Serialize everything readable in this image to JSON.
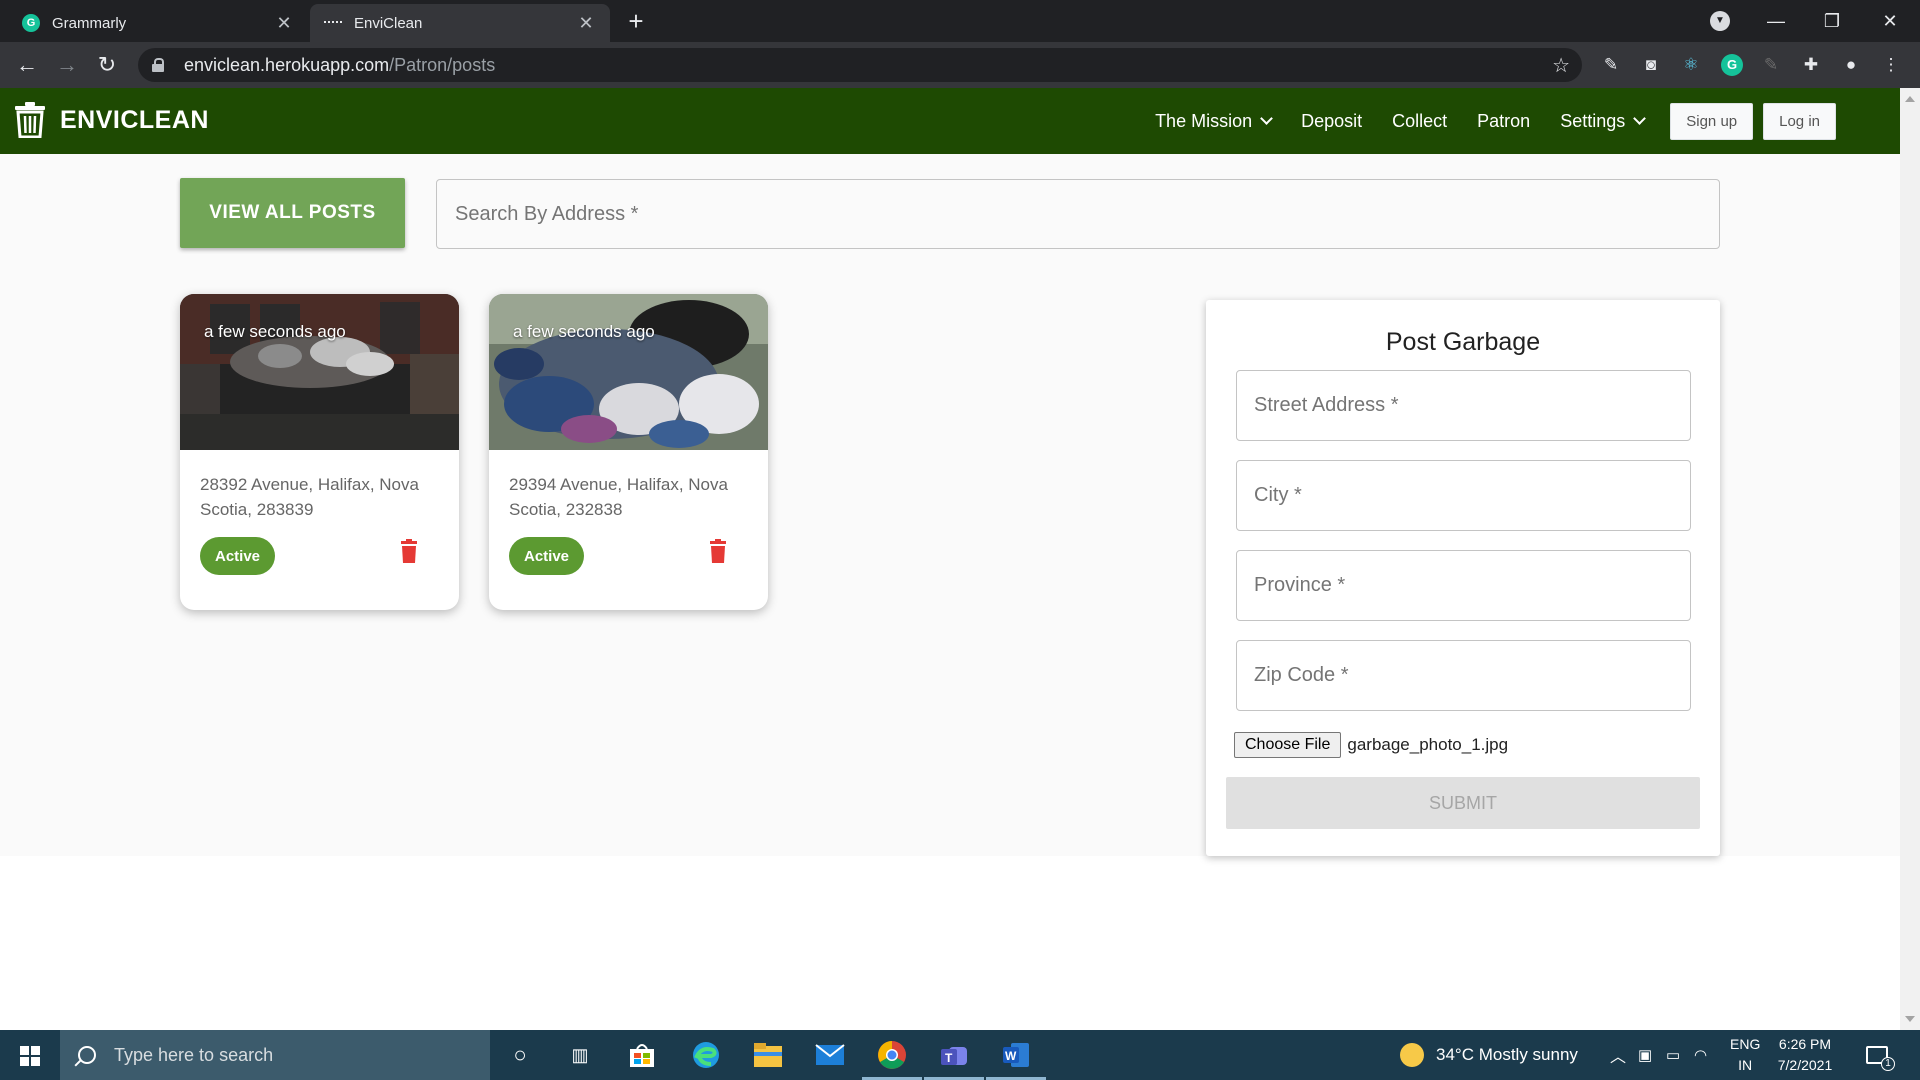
{
  "browser": {
    "tabs": [
      {
        "title": "Grammarly"
      },
      {
        "title": "EnviClean"
      }
    ],
    "url_host": "enviclean.herokuapp.com",
    "url_path": "/Patron/posts"
  },
  "site": {
    "brand": "ENVICLEAN",
    "nav": [
      {
        "label": "The Mission"
      },
      {
        "label": "Deposit"
      },
      {
        "label": "Collect"
      },
      {
        "label": "Patron"
      },
      {
        "label": "Settings"
      }
    ],
    "signup_label": "Sign up",
    "login_label": "Log in"
  },
  "toolbar": {
    "view_all_label": "VIEW ALL POSTS",
    "search_placeholder": "Search By Address *"
  },
  "posts": [
    {
      "time": "a few seconds ago",
      "address": "28392 Avenue, Halifax, Nova Scotia, 283839",
      "status": "Active"
    },
    {
      "time": "a few seconds ago",
      "address": "29394 Avenue, Halifax, Nova Scotia, 232838",
      "status": "Active"
    }
  ],
  "form": {
    "title": "Post Garbage",
    "fields": [
      {
        "label": "Street Address *"
      },
      {
        "label": "City *"
      },
      {
        "label": "Province *"
      },
      {
        "label": "Zip Code *"
      }
    ],
    "choose_file_label": "Choose File",
    "file_name": "garbage_photo_1.jpg",
    "submit_label": "SUBMIT"
  },
  "taskbar": {
    "search_placeholder": "Type here to search",
    "weather": "34°C  Mostly sunny",
    "lang_top": "ENG",
    "lang_bottom": "IN",
    "time": "6:26 PM",
    "date": "7/2/2021",
    "notification_count": "1"
  },
  "colors": {
    "header_bg": "#1e4a02",
    "view_all_bg": "#72a557",
    "badge_bg": "#5c9a31",
    "delete_red": "#e53935",
    "taskbar_bg": "#1b3a4c"
  }
}
